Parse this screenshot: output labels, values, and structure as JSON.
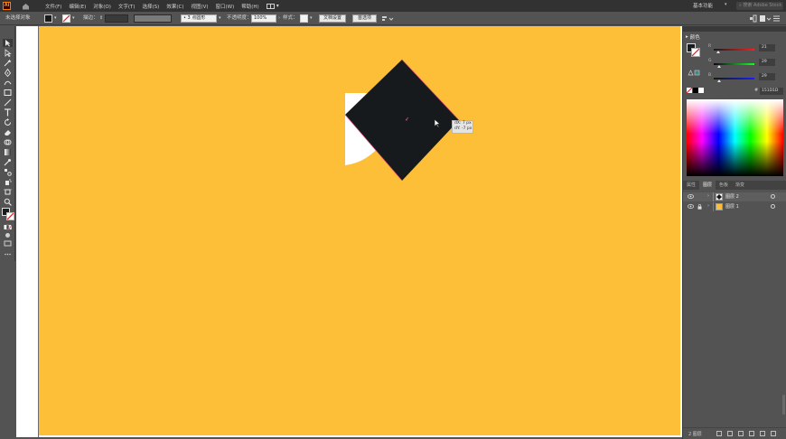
{
  "menubar": {
    "items": [
      "文件(F)",
      "编辑(E)",
      "对象(O)",
      "文字(T)",
      "选择(S)",
      "效果(C)",
      "视图(V)",
      "窗口(W)",
      "帮助(H)"
    ],
    "workspace": "基本功能",
    "stock_search_placeholder": "搜索 Adobe Stock"
  },
  "controlbar": {
    "selection_status": "未选择对象",
    "stroke_label": "描边：",
    "brush_value": "3 点圆形",
    "opacity_label": "不透明度：",
    "opacity_value": "100%",
    "style_label": "样式：",
    "doc_setup_button": "文档设置",
    "preferences_button": "首选项"
  },
  "canvas": {
    "artboard_color": "#fdbe38",
    "square_color": "#161a1c",
    "tooltip_line1": "dX: 7 px",
    "tooltip_line2": "dY: -7 px"
  },
  "color_panel": {
    "tab_label": "颜色",
    "sliders": [
      {
        "channel": "R",
        "value": "21",
        "color": "#e02020"
      },
      {
        "channel": "G",
        "value": "29",
        "color": "#20c020"
      },
      {
        "channel": "B",
        "value": "29",
        "color": "#2040e0"
      }
    ],
    "hex_label": "#",
    "hex_value": "151D1D"
  },
  "layers_panel": {
    "tabs": [
      "属性",
      "图层",
      "色板",
      "渐变"
    ],
    "active_tab": "图层",
    "layers": [
      {
        "name": "图层 2",
        "color": "#4d8ff0",
        "selected": true
      },
      {
        "name": "图层 1",
        "color": "#ff4040",
        "selected": false
      }
    ],
    "footer": "2 图层"
  }
}
